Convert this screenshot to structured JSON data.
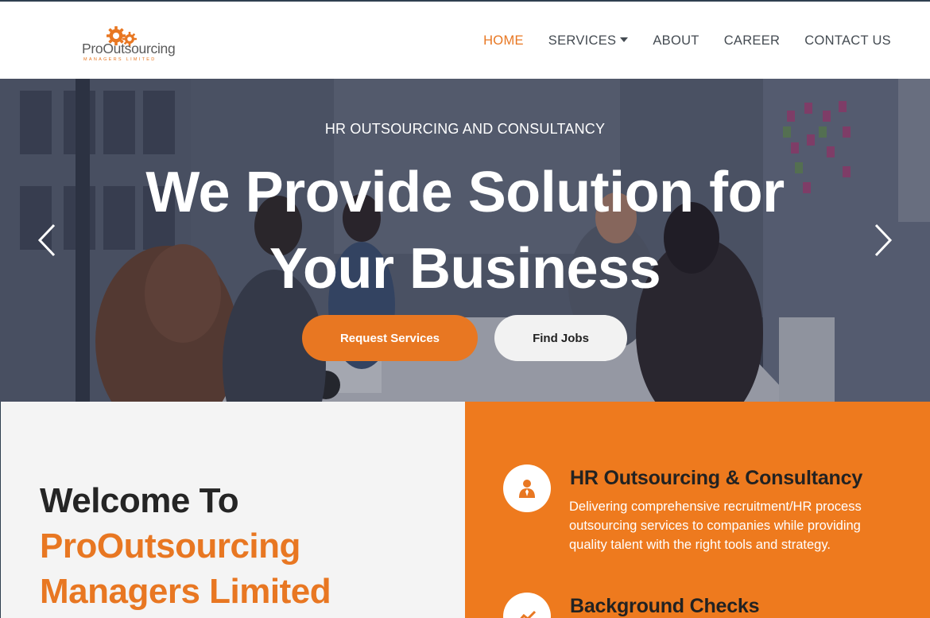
{
  "logo": {
    "name_part1": "ProO",
    "name_part2": "utsourcing",
    "tagline": "MANAGERS LIMITED"
  },
  "nav": {
    "items": [
      {
        "label": "HOME",
        "active": true
      },
      {
        "label": "SERVICES",
        "dropdown": true
      },
      {
        "label": "ABOUT"
      },
      {
        "label": "CAREER"
      },
      {
        "label": "CONTACT US"
      }
    ]
  },
  "hero": {
    "eyebrow": "HR OUTSOURCING AND CONSULTANCY",
    "title_line1": "We Provide Solution for",
    "title_line2": "Your Business",
    "primary_button": "Request Services",
    "secondary_button": "Find Jobs",
    "prev_icon": "chevron-left-icon",
    "next_icon": "chevron-right-icon"
  },
  "welcome": {
    "line1": "Welcome To",
    "line2": "ProOutsourcing",
    "line3": "Managers Limited"
  },
  "services": {
    "items": [
      {
        "icon": "person-icon",
        "title": "HR Outsourcing & Consultancy",
        "description": "Delivering comprehensive recruitment/HR process outsourcing services to companies while providing quality talent with the right tools and strategy."
      },
      {
        "icon": "chart-icon",
        "title": "Background Checks"
      }
    ]
  },
  "colors": {
    "accent": "#e87722",
    "nav_text": "#444b52",
    "hero_overlay": "#3f4658",
    "services_bg": "#ee7a1e"
  }
}
